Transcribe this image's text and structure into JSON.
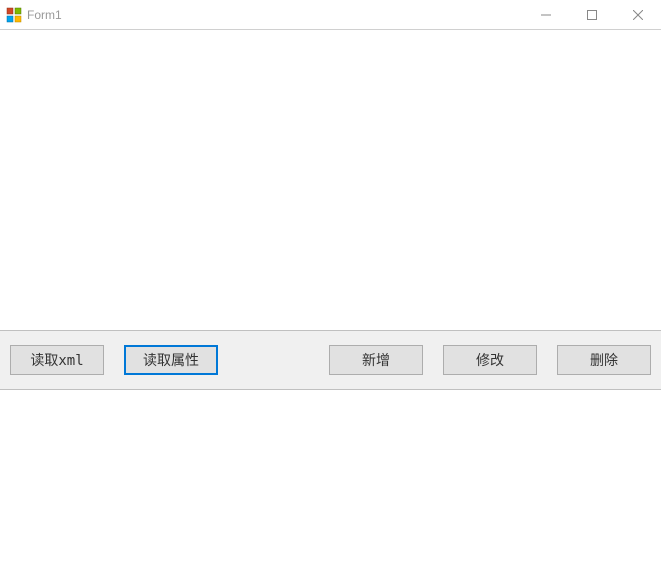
{
  "window": {
    "title": "Form1"
  },
  "buttons": {
    "read_xml": "读取xml",
    "read_attr": "读取属性",
    "add": "新增",
    "edit": "修改",
    "delete": "删除"
  }
}
